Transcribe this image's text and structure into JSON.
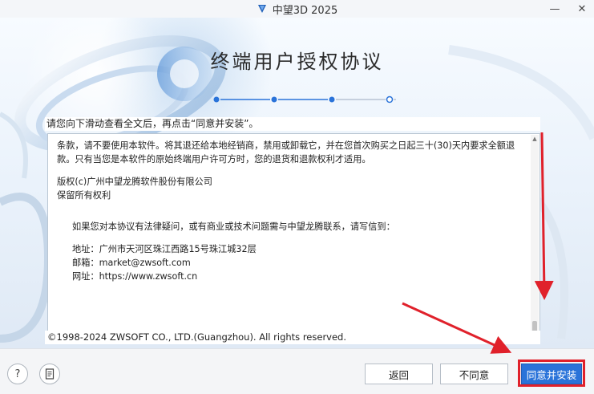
{
  "titlebar": {
    "title": "中望3D 2025",
    "minimize": "—",
    "close": "✕"
  },
  "main_title": "终端用户授权协议",
  "stepper": {
    "total_steps": 5,
    "current_step": 3
  },
  "instruction": "请您向下滑动查看全文后，再点击“同意并安装”。",
  "license": {
    "para1": "条款，请不要使用本软件。将其退还给本地经销商，禁用或卸载它，并在您首次购买之日起三十(30)天内要求全额退款。只有当您是本软件的原始终端用户许可方时，您的退货和退款权利才适用。",
    "copyright_line1": "版权(c)广州中望龙腾软件股份有限公司",
    "copyright_line2": "保留所有权利",
    "contact_intro": "如果您对本协议有法律疑问，或有商业或技术问题需与中望龙腾联系，请写信到：",
    "address": "地址：广州市天河区珠江西路15号珠江城32层",
    "email": "邮箱：market@zwsoft.com",
    "website": "网址：https://www.zwsoft.cn"
  },
  "copyright_footer": "©1998-2024 ZWSOFT CO., LTD.(Guangzhou). All rights reserved.",
  "footer": {
    "help_label": "?",
    "back_label": "返回",
    "disagree_label": "不同意",
    "agree_label": "同意并安装"
  },
  "colors": {
    "accent": "#2a73d9",
    "annotation_red": "#e0212b",
    "step_active": "#2a73d9",
    "step_inactive": "#b7c4d3"
  }
}
